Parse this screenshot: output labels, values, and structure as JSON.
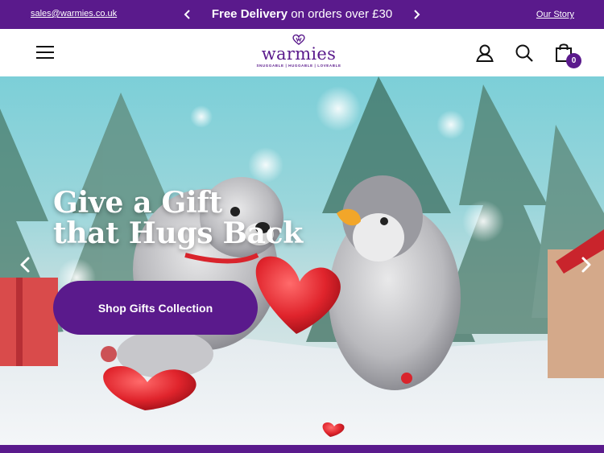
{
  "announcement": {
    "email": "sales@warmies.co.uk",
    "promo_bold": "Free Delivery",
    "promo_rest": " on orders over £30",
    "story_link": "Our Story",
    "prev_icon": "chevron-left-icon",
    "next_icon": "chevron-right-icon"
  },
  "header": {
    "logo_text": "warmies",
    "logo_tagline": "SNUGGABLE | HUGGABLE | LOVEABLE",
    "menu_icon": "hamburger-menu-icon",
    "account_icon": "user-icon",
    "search_icon": "search-icon",
    "cart_icon": "shopping-bag-icon",
    "cart_count": "0"
  },
  "hero": {
    "headline_line1": "Give a Gift",
    "headline_line2": "that Hugs Back",
    "cta_label": "Shop Gifts Collection",
    "prev_icon": "chevron-left-icon",
    "next_icon": "chevron-right-icon"
  },
  "colors": {
    "brand_purple": "#5a1a8c",
    "white": "#ffffff"
  }
}
